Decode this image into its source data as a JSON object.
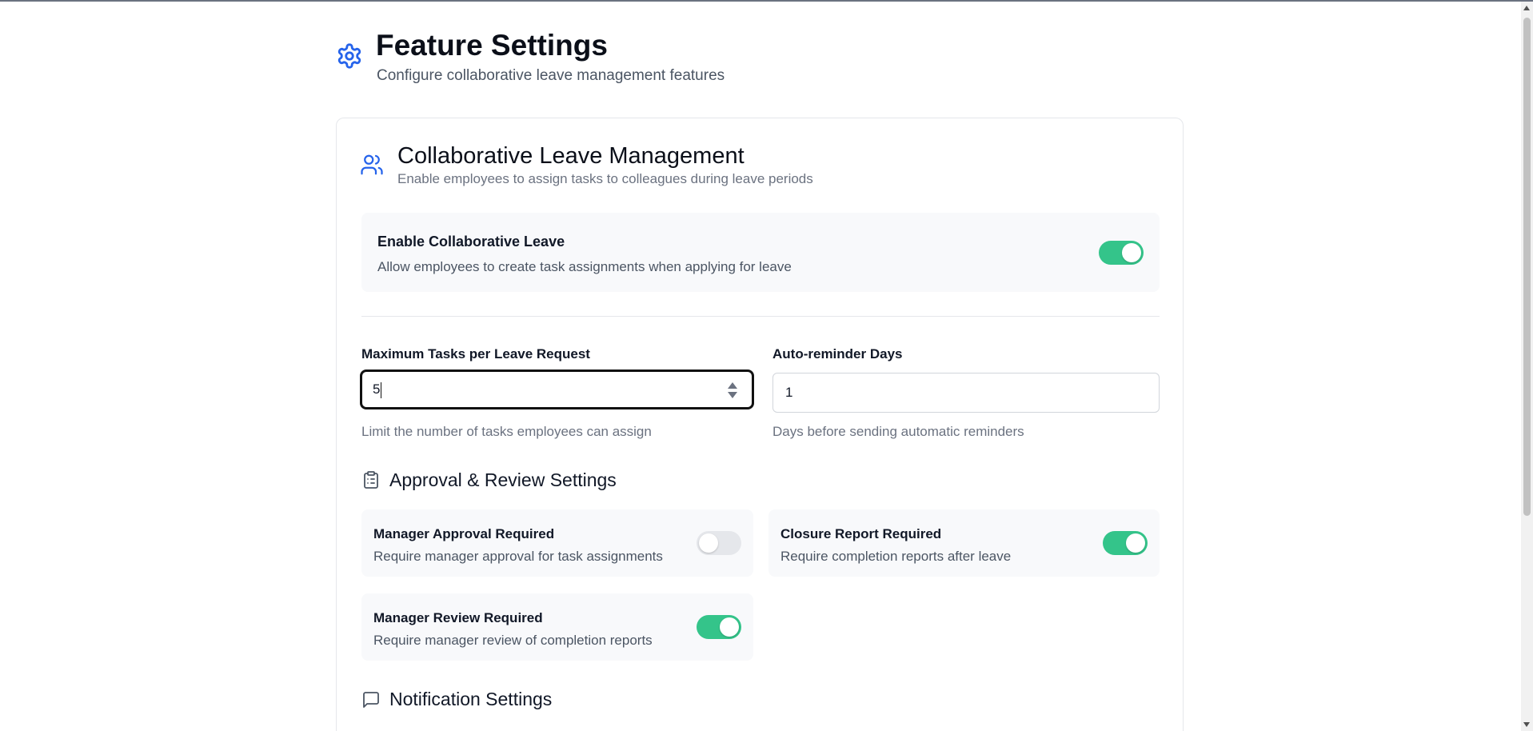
{
  "header": {
    "title": "Feature Settings",
    "subtitle": "Configure collaborative leave management features",
    "icon": "gear-icon",
    "accent_color": "#2563eb"
  },
  "card": {
    "title": "Collaborative Leave Management",
    "subtitle": "Enable employees to assign tasks to colleagues during leave periods",
    "icon": "users-icon"
  },
  "enable_collab": {
    "title": "Enable Collaborative Leave",
    "description": "Allow employees to create task assignments when applying for leave",
    "enabled": true
  },
  "fields": {
    "max_tasks": {
      "label": "Maximum Tasks per Leave Request",
      "value": "5",
      "help": "Limit the number of tasks employees can assign"
    },
    "reminder_days": {
      "label": "Auto-reminder Days",
      "value": "1",
      "help": "Days before sending automatic reminders"
    }
  },
  "approval_section": {
    "title": "Approval & Review Settings",
    "icon": "clipboard-icon",
    "settings": [
      {
        "title": "Manager Approval Required",
        "description": "Require manager approval for task assignments",
        "enabled": false
      },
      {
        "title": "Closure Report Required",
        "description": "Require completion reports after leave",
        "enabled": true
      },
      {
        "title": "Manager Review Required",
        "description": "Require manager review of completion reports",
        "enabled": true
      }
    ]
  },
  "notification_section": {
    "title": "Notification Settings",
    "icon": "message-icon"
  },
  "colors": {
    "toggle_on": "#34c48a",
    "toggle_off": "#e5e7eb"
  }
}
